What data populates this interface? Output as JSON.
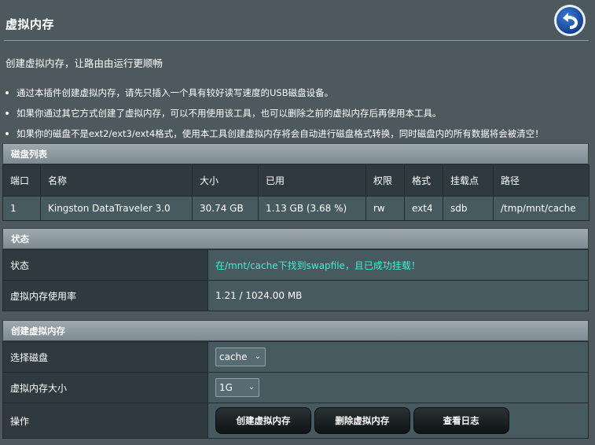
{
  "page": {
    "title": "虚拟内存",
    "subtitle": "创建虚拟内存，让路由由运行更顺畅",
    "notes": [
      "通过本插件创建虚拟内存，请先只插入一个具有较好读写速度的USB磁盘设备。",
      "如果你通过其它方式创建了虚拟内存，可以不用使用该工具，也可以删除之前的虚拟内存后再使用本工具。",
      "如果你的磁盘不是ext2/ext3/ext4格式，使用本工具创建虚拟内存将会自动进行磁盘格式转换，同时磁盘内的所有数据将会被清空！"
    ]
  },
  "disk_list": {
    "heading": "磁盘列表",
    "columns": [
      "端口",
      "名称",
      "大小",
      "已用",
      "权限",
      "格式",
      "挂载点",
      "路径"
    ],
    "rows": [
      [
        "1",
        "Kingston DataTraveler 3.0",
        "30.74 GB",
        "1.13 GB (3.68 %)",
        "rw",
        "ext4",
        "sdb",
        "/tmp/mnt/cache"
      ]
    ]
  },
  "status": {
    "heading": "状态",
    "status_label": "状态",
    "status_value": "在/mnt/cache下找到swapfile，且已成功挂载！",
    "status_color": "#3ff0d5",
    "usage_label": "虚拟内存使用率",
    "usage_value": "1.21 / 1024.00 MB"
  },
  "create": {
    "heading": "创建虚拟内存",
    "disk_label": "选择磁盘",
    "disk_value": "cache",
    "size_label": "虚拟内存大小",
    "size_value": "1G",
    "action_label": "操作",
    "create_button": "创建虚拟内存",
    "delete_button": "删除虚拟内存",
    "log_button": "查看日志"
  },
  "icons": {
    "back": "back-arrow-icon",
    "dropdown": "chevron-down-icon"
  }
}
